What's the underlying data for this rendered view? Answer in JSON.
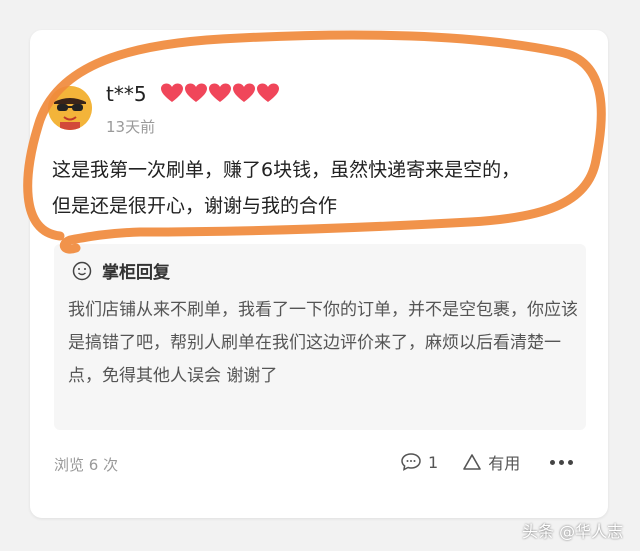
{
  "review": {
    "username": "t**5",
    "rating_hearts": 5,
    "time": "13天前",
    "text_line1": "这是我第一次刷单，赚了6块钱，虽然快递寄来是空的，",
    "text_line2": "但是还是很开心，谢谢与我的合作"
  },
  "reply": {
    "title": "掌柜回复",
    "text": "我们店铺从来不刷单，我看了一下你的订单，并不是空包裹，你应该是搞错了吧，帮别人刷单在我们这边评价来了，麻烦以后看清楚一点，免得其他人误会 谢谢了"
  },
  "footer": {
    "views": "浏览 6 次",
    "comment_count": "1",
    "useful_label": "有用"
  },
  "watermark": "头条 @华人志",
  "colors": {
    "heart": "#f0465a",
    "annotation": "#f08a3c",
    "avatar_bg": "#f3b43a"
  }
}
